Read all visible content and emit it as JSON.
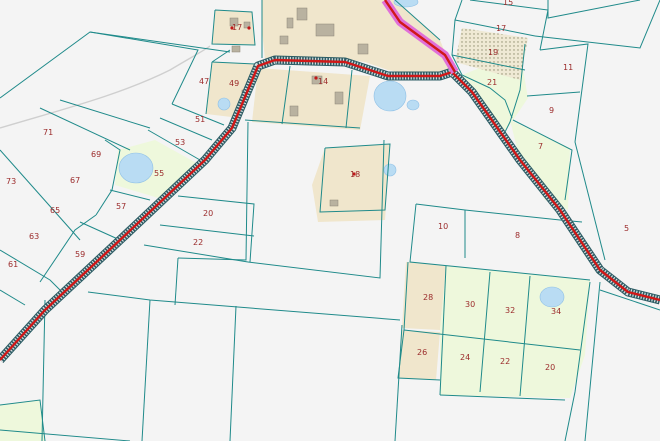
{
  "map": {
    "colors": {
      "background": "#f4f4f4",
      "parcel_line": "#1f8a8a",
      "settlement_fill": "#f0e6cc",
      "meadow_fill": "#eef8dc",
      "water_fill": "#b9dcf3",
      "road_outer": "#2c5c64",
      "road_center": "#d01818",
      "road_pink": "#e070d8",
      "building_fill": "#b9b2a0",
      "dirt_track": "#cfcfcf"
    },
    "plots": [
      {
        "id": "p15",
        "label": "15"
      },
      {
        "id": "p17",
        "label": "17"
      },
      {
        "id": "p19",
        "label": "19"
      },
      {
        "id": "p11",
        "label": "11"
      },
      {
        "id": "p21",
        "label": "21"
      },
      {
        "id": "p9",
        "label": "9"
      },
      {
        "id": "p7",
        "label": "7"
      },
      {
        "id": "p5",
        "label": "5"
      },
      {
        "id": "p47",
        "label": "47"
      },
      {
        "id": "p49",
        "label": "49"
      },
      {
        "id": "p14",
        "label": "14"
      },
      {
        "id": "p71",
        "label": "71"
      },
      {
        "id": "p69",
        "label": "69"
      },
      {
        "id": "p51",
        "label": "51"
      },
      {
        "id": "p53",
        "label": "53"
      },
      {
        "id": "p73",
        "label": "73"
      },
      {
        "id": "p67",
        "label": "67"
      },
      {
        "id": "p55",
        "label": "55"
      },
      {
        "id": "p18",
        "label": "18"
      },
      {
        "id": "p65",
        "label": "65"
      },
      {
        "id": "p57",
        "label": "57"
      },
      {
        "id": "p20",
        "label": "20"
      },
      {
        "id": "p63",
        "label": "63"
      },
      {
        "id": "p22a",
        "label": "22"
      },
      {
        "id": "p61",
        "label": "61"
      },
      {
        "id": "p59",
        "label": "59"
      },
      {
        "id": "p10",
        "label": "10"
      },
      {
        "id": "p8",
        "label": "8"
      },
      {
        "id": "p28",
        "label": "28"
      },
      {
        "id": "p30",
        "label": "30"
      },
      {
        "id": "p32",
        "label": "32"
      },
      {
        "id": "p34",
        "label": "34"
      },
      {
        "id": "p26",
        "label": "26"
      },
      {
        "id": "p24",
        "label": "24"
      },
      {
        "id": "p22b",
        "label": "22"
      },
      {
        "id": "p20b",
        "label": "20"
      },
      {
        "id": "p17top",
        "label": "17"
      }
    ]
  }
}
